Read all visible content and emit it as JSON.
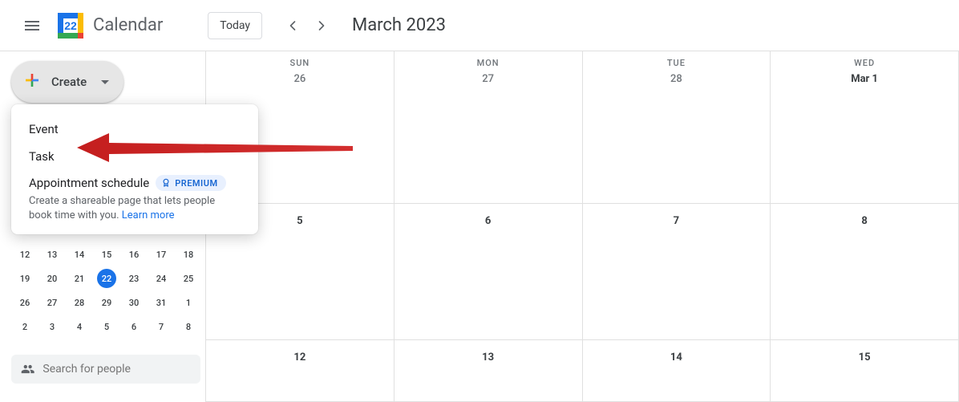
{
  "header": {
    "app_name": "Calendar",
    "logo_day": "22",
    "today_label": "Today",
    "month_title": "March 2023"
  },
  "create": {
    "label": "Create"
  },
  "dropdown": {
    "event": "Event",
    "task": "Task",
    "appt_label": "Appointment schedule",
    "premium": "PREMIUM",
    "appt_desc": "Create a shareable page that lets people book time with you. ",
    "learn_more": "Learn more"
  },
  "mini_cal": {
    "rows": [
      [
        "12",
        "13",
        "14",
        "15",
        "16",
        "17",
        "18"
      ],
      [
        "19",
        "20",
        "21",
        "22",
        "23",
        "24",
        "25"
      ],
      [
        "26",
        "27",
        "28",
        "29",
        "30",
        "31",
        "1"
      ],
      [
        "2",
        "3",
        "4",
        "5",
        "6",
        "7",
        "8"
      ]
    ],
    "today": "22"
  },
  "search": {
    "placeholder": "Search for people"
  },
  "grid": {
    "row1": [
      {
        "dow": "SUN",
        "date": "26",
        "bold": false
      },
      {
        "dow": "MON",
        "date": "27",
        "bold": false
      },
      {
        "dow": "TUE",
        "date": "28",
        "bold": false
      },
      {
        "dow": "WED",
        "date": "Mar 1",
        "bold": true
      }
    ],
    "row2": [
      {
        "date": "5"
      },
      {
        "date": "6"
      },
      {
        "date": "7"
      },
      {
        "date": "8"
      }
    ],
    "row3": [
      {
        "date": "12"
      },
      {
        "date": "13"
      },
      {
        "date": "14"
      },
      {
        "date": "15"
      }
    ]
  }
}
